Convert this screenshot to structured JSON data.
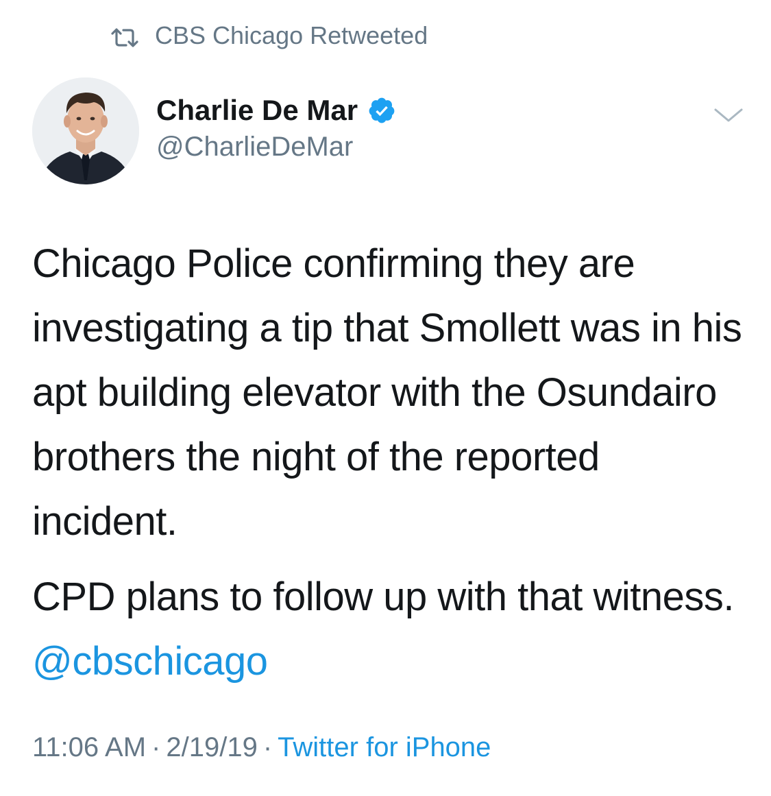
{
  "retweet": {
    "icon": "retweet-icon",
    "label": "CBS Chicago Retweeted"
  },
  "author": {
    "avatar": "profile-photo",
    "display_name": "Charlie De Mar",
    "verified_icon": "verified-badge-icon",
    "handle": "@CharlieDeMar"
  },
  "menu": {
    "icon": "chevron-down-icon"
  },
  "tweet": {
    "paragraph1": "Chicago Police confirming they are investigating a tip that Smollett was in his apt building elevator with the Osundairo brothers the night of the reported incident.",
    "paragraph2_text": "CPD plans to follow up with that witness. ",
    "mention": "@cbschicago"
  },
  "meta": {
    "time": "11:06 AM",
    "separator1": "·",
    "date": "2/19/19",
    "separator2": "·",
    "source": "Twitter for iPhone"
  },
  "colors": {
    "link": "#1b95e0",
    "secondary_text": "#657786",
    "primary_text": "#14171a"
  }
}
